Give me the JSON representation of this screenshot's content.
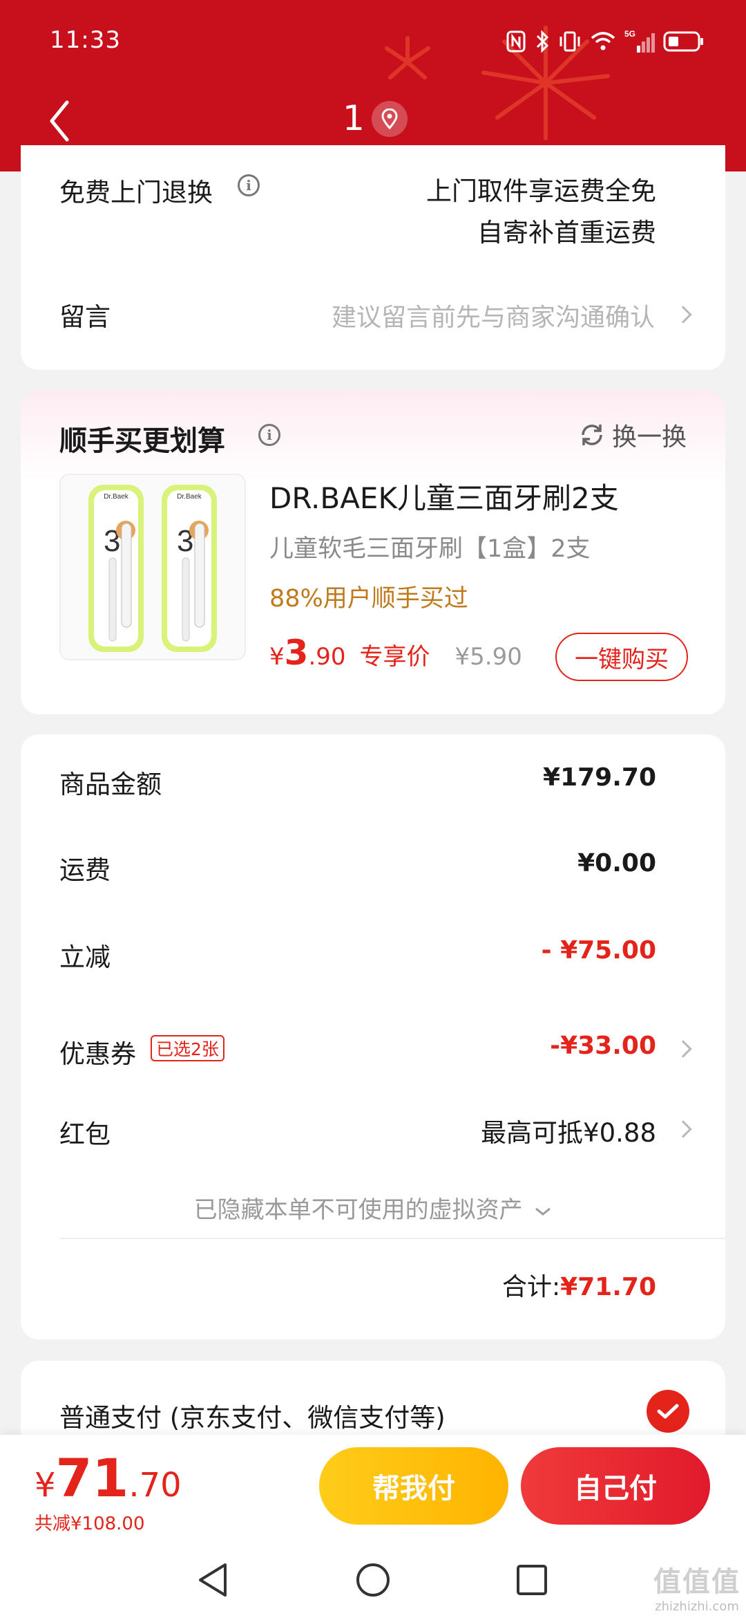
{
  "status_bar": {
    "time": "11:33",
    "network": "5G"
  },
  "nav": {
    "title": "1"
  },
  "shipping": {
    "return_label": "免费上门退换",
    "return_desc_line1": "上门取件享运费全免",
    "return_desc_line2": "自寄补首重运费",
    "message_label": "留言",
    "message_placeholder": "建议留言前先与商家沟通确认"
  },
  "addon": {
    "title": "顺手买更划算",
    "swap_label": "换一换",
    "product": {
      "name": "DR.BAEK儿童三面牙刷2支",
      "subtitle": "儿童软毛三面牙刷【1盒】2支",
      "popularity": "88%用户顺手买过",
      "price_currency": "¥",
      "price_int": "3",
      "price_dec": ".90",
      "exclusive_label": "专享价",
      "original_price": "¥5.90",
      "buy_label": "一键购买",
      "package_text": "Dr.Baek"
    }
  },
  "summary": {
    "rows": [
      {
        "label": "商品金额",
        "value": "¥179.70"
      },
      {
        "label": "运费",
        "value": "¥0.00"
      },
      {
        "label": "立减",
        "value": "- ¥75.00"
      },
      {
        "label": "优惠券",
        "value": "-¥33.00",
        "badge": "已选2张"
      },
      {
        "label": "红包",
        "value": "最高可抵¥0.88"
      }
    ],
    "hidden_assets": "已隐藏本单不可使用的虚拟资产",
    "total_label": "合计:",
    "total_value": "¥71.70"
  },
  "payment": {
    "method_label": "普通支付 (京东支付、微信支付等)"
  },
  "bottom": {
    "currency": "¥",
    "total_int": "71",
    "total_dec": ".70",
    "saved": "共减¥108.00",
    "help_pay": "帮我付",
    "self_pay": "自己付"
  },
  "watermark": {
    "logo": "值值值",
    "url": "zhizhizhi.com"
  },
  "colors": {
    "header_red": "#c8101d",
    "accent_red": "#e4231b",
    "gold": "#c07a1b",
    "yellow_btn": "#ffbf0f"
  }
}
